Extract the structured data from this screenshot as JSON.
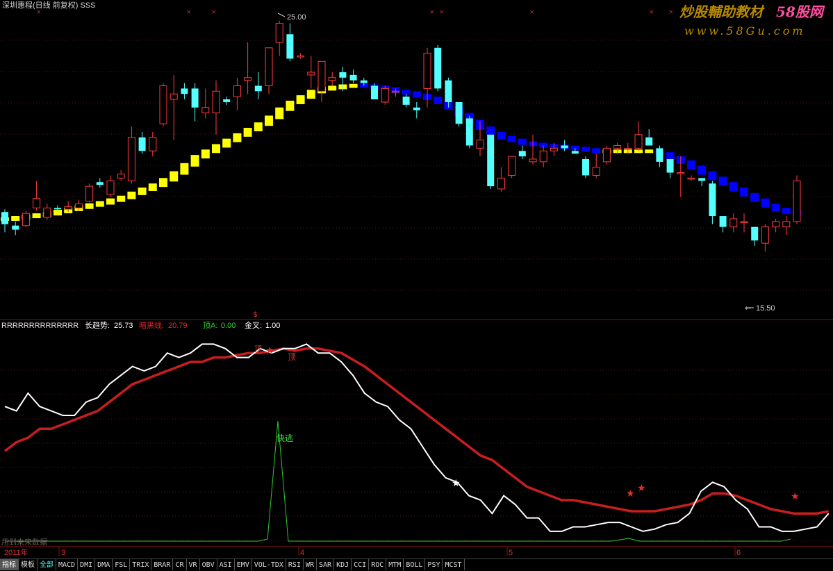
{
  "window": {
    "title": "深圳惠程(日线 前复权) SSS",
    "watermark_main": "炒股輔助教材",
    "watermark_site": "58股网",
    "watermark_url": "www.58Gu.com"
  },
  "price_panel": {
    "high_label": "25.00",
    "low_label": "15.50"
  },
  "indicator_panel": {
    "name": "RRRRRRRRRRRRRR",
    "items": [
      {
        "label": "长趋势:",
        "value": "25.73",
        "color": "#ffffff"
      },
      {
        "label": "暗黑线:",
        "value": "20.79",
        "color": "#e0282a"
      },
      {
        "label": "顶A:",
        "value": "0.00",
        "color": "#36d336"
      },
      {
        "label": "金叉:",
        "value": "1.00",
        "color": "#ffffff"
      }
    ],
    "annotation_fast_escape": "快逃",
    "annotation_ding": "顶",
    "annotation_dollar": "$",
    "source_note": "用到未来数据"
  },
  "time_axis": {
    "labels": [
      "2011年",
      "3",
      "4",
      "5",
      "6"
    ]
  },
  "tabs": [
    "指标",
    "模板",
    "全部",
    "MACD",
    "DMI",
    "DMA",
    "FSL",
    "TRIX",
    "BRAR",
    "CR",
    "VR",
    "OBV",
    "ASI",
    "EMV",
    "VOL-TDX",
    "RSI",
    "WR",
    "SAR",
    "KDJ",
    "CCI",
    "ROC",
    "MTM",
    "BOLL",
    "PSY",
    "MCST"
  ],
  "colors": {
    "up": "#ff3c3c",
    "down": "#54ffff",
    "trend_up": "#ffff00",
    "trend_down": "#0000ff",
    "long_trend": "#ffffff",
    "dark_line": "#c81e1e",
    "signal": "#2ecc2e"
  },
  "chart_data": [
    {
      "type": "candlestick",
      "title": "深圳惠程(日线 前复权) SSS",
      "ylim": [
        14.5,
        25.3
      ],
      "annotations": [
        {
          "text": "25.00",
          "point": "high"
        },
        {
          "text": "15.50",
          "point": "low"
        }
      ],
      "ohlc": [
        [
          17.95,
          18.05,
          17.2,
          17.5
        ],
        [
          17.45,
          17.6,
          17.1,
          17.3
        ],
        [
          17.45,
          18.0,
          17.4,
          17.9
        ],
        [
          18.1,
          19.1,
          18.0,
          18.45
        ],
        [
          17.75,
          18.25,
          17.65,
          18.1
        ],
        [
          18.1,
          18.2,
          17.95,
          18.05
        ],
        [
          18.05,
          18.35,
          17.95,
          18.15
        ],
        [
          18.1,
          18.4,
          18.0,
          18.25
        ],
        [
          18.35,
          19.0,
          18.3,
          18.9
        ],
        [
          19.05,
          19.2,
          18.85,
          18.95
        ],
        [
          18.6,
          19.3,
          18.5,
          19.1
        ],
        [
          19.2,
          19.5,
          19.1,
          19.35
        ],
        [
          19.1,
          21.1,
          19.0,
          20.7
        ],
        [
          20.7,
          20.9,
          20.1,
          20.2
        ],
        [
          20.2,
          20.9,
          20.0,
          20.7
        ],
        [
          21.2,
          22.7,
          21.1,
          22.6
        ],
        [
          22.1,
          23.0,
          20.6,
          22.3
        ],
        [
          22.5,
          22.7,
          22.1,
          22.3
        ],
        [
          22.5,
          22.7,
          21.3,
          21.8
        ],
        [
          21.6,
          22.5,
          21.4,
          21.8
        ],
        [
          21.6,
          22.8,
          20.8,
          22.4
        ],
        [
          22.1,
          22.2,
          21.9,
          22.0
        ],
        [
          22.2,
          22.9,
          21.7,
          22.6
        ],
        [
          22.8,
          24.2,
          22.3,
          22.9
        ],
        [
          22.6,
          23.1,
          22.1,
          22.4
        ],
        [
          22.6,
          24.0,
          22.3,
          24.0
        ],
        [
          24.2,
          25.0,
          23.7,
          24.9
        ],
        [
          24.5,
          24.9,
          23.5,
          23.6
        ],
        [
          23.7,
          23.8,
          23.6,
          23.7
        ],
        [
          23.0,
          23.7,
          22.5,
          23.1
        ],
        [
          22.4,
          23.5,
          22.0,
          23.5
        ],
        [
          22.8,
          23.1,
          22.6,
          22.9
        ],
        [
          23.1,
          23.3,
          22.4,
          22.9
        ],
        [
          23.0,
          23.2,
          22.7,
          22.8
        ],
        [
          22.8,
          22.9,
          22.6,
          22.7
        ],
        [
          22.6,
          22.7,
          22.1,
          22.1
        ],
        [
          22.0,
          22.6,
          21.9,
          22.5
        ],
        [
          22.4,
          22.5,
          22.2,
          22.4
        ],
        [
          22.2,
          22.3,
          21.8,
          21.9
        ],
        [
          21.8,
          22.0,
          21.4,
          21.7
        ],
        [
          22.5,
          24.0,
          21.8,
          23.8
        ],
        [
          24.0,
          24.1,
          22.4,
          22.5
        ],
        [
          22.8,
          22.9,
          21.8,
          22.0
        ],
        [
          22.0,
          22.0,
          21.1,
          21.2
        ],
        [
          21.4,
          21.5,
          20.3,
          20.4
        ],
        [
          20.3,
          21.3,
          20.0,
          20.6
        ],
        [
          20.8,
          20.8,
          18.8,
          18.9
        ],
        [
          18.8,
          19.6,
          18.7,
          19.2
        ],
        [
          19.3,
          20.0,
          19.2,
          20.0
        ],
        [
          20.2,
          20.4,
          19.9,
          20.0
        ],
        [
          19.8,
          20.8,
          19.7,
          19.9
        ],
        [
          19.8,
          20.4,
          19.6,
          20.2
        ],
        [
          20.2,
          20.5,
          20.0,
          20.3
        ],
        [
          20.4,
          20.6,
          20.2,
          20.3
        ],
        [
          20.2,
          20.3,
          20.1,
          20.1
        ],
        [
          19.9,
          20.0,
          19.2,
          19.3
        ],
        [
          19.3,
          20.1,
          19.2,
          19.6
        ],
        [
          19.8,
          20.4,
          19.7,
          20.3
        ],
        [
          20.3,
          20.5,
          20.1,
          20.4
        ],
        [
          20.3,
          20.5,
          20.1,
          20.3
        ],
        [
          20.3,
          21.3,
          20.2,
          20.8
        ],
        [
          20.7,
          21.0,
          20.4,
          20.4
        ],
        [
          20.3,
          20.4,
          19.6,
          19.8
        ],
        [
          19.9,
          19.9,
          19.2,
          19.4
        ],
        [
          19.4,
          20.0,
          18.5,
          19.4
        ],
        [
          19.2,
          19.3,
          19.1,
          19.2
        ],
        [
          19.2,
          19.2,
          18.9,
          19.1
        ],
        [
          19.0,
          19.1,
          17.5,
          17.8
        ],
        [
          17.8,
          17.8,
          17.2,
          17.4
        ],
        [
          17.4,
          17.9,
          17.2,
          17.7
        ],
        [
          17.6,
          17.9,
          17.2,
          17.6
        ],
        [
          17.4,
          17.4,
          16.7,
          16.9
        ],
        [
          16.8,
          17.5,
          16.5,
          17.4
        ],
        [
          17.4,
          17.7,
          17.2,
          17.6
        ],
        [
          17.4,
          17.8,
          17.1,
          17.6
        ],
        [
          17.6,
          19.3,
          17.5,
          19.1
        ]
      ],
      "trend_line": [
        17.7,
        17.75,
        17.8,
        17.85,
        17.9,
        17.98,
        18.06,
        18.14,
        18.22,
        18.3,
        18.4,
        18.5,
        18.65,
        18.8,
        18.95,
        19.15,
        19.4,
        19.7,
        20.0,
        20.2,
        20.4,
        20.6,
        20.8,
        21.0,
        21.2,
        21.45,
        21.75,
        22.0,
        22.2,
        22.4,
        22.5,
        22.55,
        22.6,
        22.62,
        22.6,
        22.55,
        22.5,
        22.4,
        22.35,
        22.25,
        22.15,
        22.0,
        21.8,
        21.55,
        21.3,
        21.05,
        20.85,
        20.7,
        20.6,
        20.5,
        20.45,
        20.4,
        20.38,
        20.34,
        20.3,
        20.25,
        20.2,
        20.2,
        20.2,
        20.2,
        20.2,
        20.2,
        20.1,
        19.95,
        19.8,
        19.6,
        19.4,
        19.2,
        19.0,
        18.8,
        18.6,
        18.4,
        18.2,
        18.05,
        17.95,
        17.9
      ]
    },
    {
      "type": "line",
      "series": [
        {
          "name": "长趋势",
          "values": [
            25.73
          ]
        },
        {
          "name": "暗黑线",
          "values": [
            20.79
          ]
        },
        {
          "name": "顶A",
          "values": [
            0.0
          ]
        },
        {
          "name": "金叉",
          "values": [
            1.0
          ]
        }
      ]
    }
  ]
}
